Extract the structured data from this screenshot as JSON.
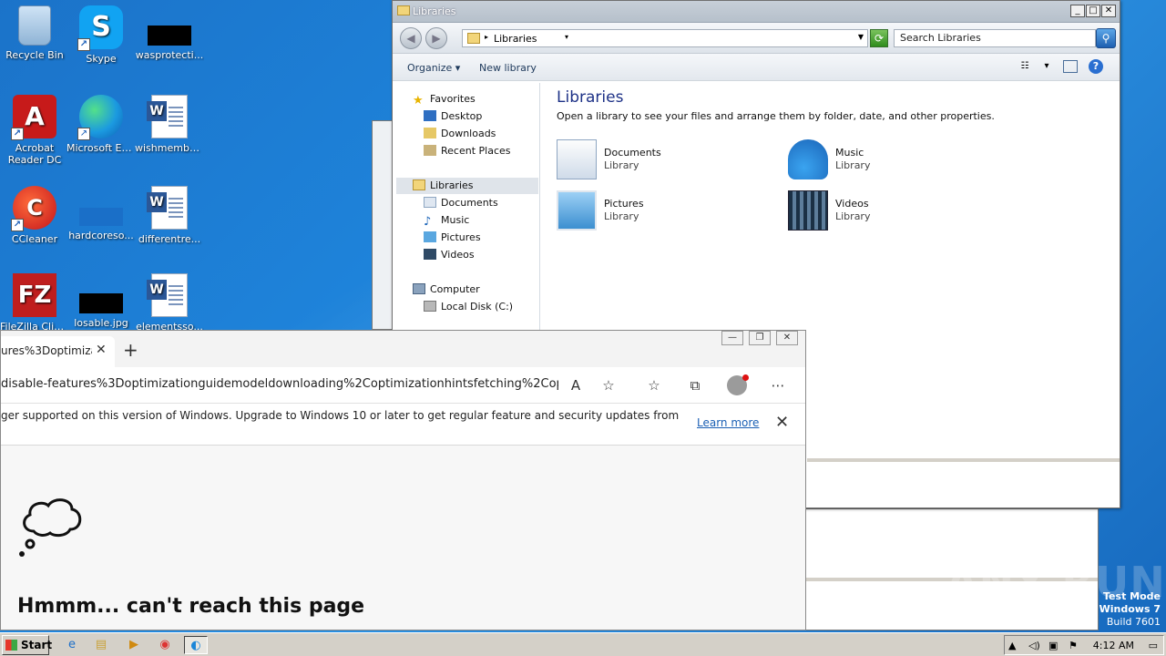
{
  "desktop": {
    "icons": [
      {
        "label": "Recycle Bin",
        "icon": "recycle-bin-icon"
      },
      {
        "label": "Skype",
        "icon": "skype-icon"
      },
      {
        "label": "wasprotecti...",
        "icon": "black-file-icon"
      },
      {
        "label": "Acrobat Reader DC",
        "icon": "acrobat-icon"
      },
      {
        "label": "Microsoft Edge",
        "icon": "edge-icon"
      },
      {
        "label": "wishmember...",
        "icon": "word-doc-icon"
      },
      {
        "label": "CCleaner",
        "icon": "ccleaner-icon"
      },
      {
        "label": "hardcoreso...",
        "icon": "blue-file-icon"
      },
      {
        "label": "differentre...",
        "icon": "word-doc-icon"
      },
      {
        "label": "FileZilla Client",
        "icon": "filezilla-icon"
      },
      {
        "label": "losable.jpg",
        "icon": "black-file-icon"
      },
      {
        "label": "elementsso...",
        "icon": "word-doc-icon"
      }
    ]
  },
  "explorer": {
    "title": "Libraries",
    "breadcrumb": "Libraries",
    "search_placeholder": "Search Libraries",
    "toolbar": {
      "organize": "Organize",
      "new_library": "New library"
    },
    "nav": {
      "favorites": "Favorites",
      "favorites_items": [
        "Desktop",
        "Downloads",
        "Recent Places"
      ],
      "libraries": "Libraries",
      "libraries_items": [
        "Documents",
        "Music",
        "Pictures",
        "Videos"
      ],
      "computer": "Computer",
      "computer_items": [
        "Local Disk (C:)"
      ]
    },
    "heading": "Libraries",
    "subheading": "Open a library to see your files and arrange them by folder, date, and other properties.",
    "libraries": [
      {
        "name": "Documents",
        "type": "Library"
      },
      {
        "name": "Music",
        "type": "Library"
      },
      {
        "name": "Pictures",
        "type": "Library"
      },
      {
        "name": "Videos",
        "type": "Library"
      }
    ]
  },
  "edge": {
    "tab_title": "ures%3Doptimizati",
    "url": "disable-features%3Doptimizationguidemodeldownloading%2Coptimizationhintsfetching%2Coptim...",
    "info_message": "ger supported on this version of Windows. Upgrade to Windows 10 or later to get regular feature and security updates from",
    "learn_more": "Learn more",
    "error_title": "Hmmm... can't reach this page"
  },
  "taskbar": {
    "start_label": "Start",
    "clock": "4:12 AM"
  },
  "watermark": "ANY RUN",
  "test_mode": {
    "line1": "Test Mode",
    "line2": "Windows 7",
    "line3": "Build 7601"
  }
}
